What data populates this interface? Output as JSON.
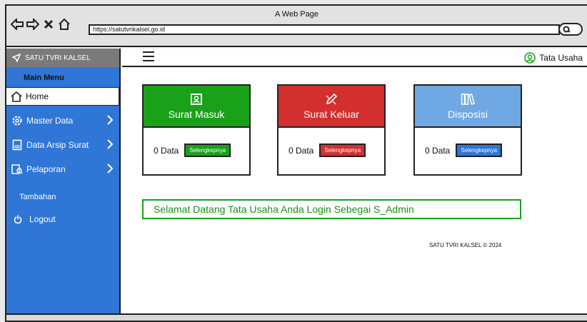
{
  "window": {
    "title": "A Web Page",
    "url": "https://satutvrikalsel.go.id"
  },
  "sidebar": {
    "brand": "SATU TVRI KALSEL",
    "menu_heading": "Main Menu",
    "items": [
      {
        "label": "Home",
        "icon": "home-icon"
      },
      {
        "label": "Master Data",
        "icon": "gear-icon"
      },
      {
        "label": "Data Arsip Surat",
        "icon": "archive-icon"
      },
      {
        "label": "Pelaporan",
        "icon": "report-icon"
      }
    ],
    "section_label": "Tambahan",
    "logout_label": "Logout"
  },
  "topbar": {
    "user_name": "Tata Usaha"
  },
  "cards": [
    {
      "title": "Surat Masuk",
      "count": "0 Data",
      "button": "Selengkepnya",
      "color": "#1aa11a",
      "icon": "inbox-icon"
    },
    {
      "title": "Surat Keluar",
      "count": "0 Data",
      "button": "Selengkepnya",
      "color": "#d32f2f",
      "icon": "edit-icon"
    },
    {
      "title": "Disposisi",
      "count": "0 Data",
      "button": "Selengkepnya",
      "color": "#6fa8e3",
      "icon": "books-icon"
    }
  ],
  "welcome_message": "Selamat Datang Tata Usaha Anda Login Sebegai S_Admin",
  "footer": "SATU TVRI KALSEL © 2024",
  "colors": {
    "sidebar": "#2f76d6",
    "brand_bar": "#7a7a7a",
    "success": "#1aa11a",
    "danger": "#d32f2f",
    "info": "#2f76d6"
  }
}
